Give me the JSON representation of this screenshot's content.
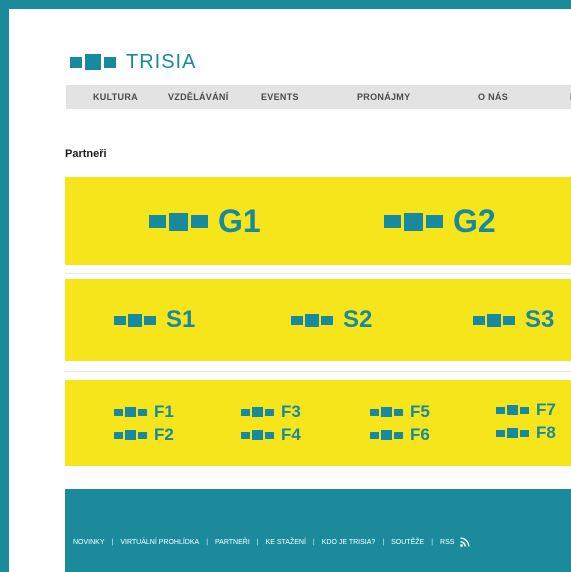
{
  "brand": {
    "name": "TRISIA",
    "color": "#178aa0"
  },
  "nav": {
    "items": [
      "KULTURA",
      "VZDĚLÁVÁNÍ",
      "EVENTS",
      "PRONÁJMY",
      "O NÁS",
      "MU"
    ]
  },
  "section_title": "Partneři",
  "partners": {
    "gold": [
      "G1",
      "G2"
    ],
    "silver": [
      "S1",
      "S2",
      "S3"
    ],
    "friends": [
      "F1",
      "F2",
      "F3",
      "F4",
      "F5",
      "F6",
      "F7",
      "F8"
    ]
  },
  "footer": {
    "links": [
      "NOVINKY",
      "VIRTUÁLNÍ PROHLÍDKA",
      "PARTNEŘI",
      "KE STAŽENÍ",
      "KDO JE TRISIA?",
      "SOUTĚŽE",
      "RSS"
    ],
    "separator": "|",
    "rss_icon": "rss-icon"
  },
  "colors": {
    "accent": "#178aa0",
    "band": "#f6e51a",
    "frame": "#1b8b9c",
    "nav_bg": "#e3e3e3"
  }
}
